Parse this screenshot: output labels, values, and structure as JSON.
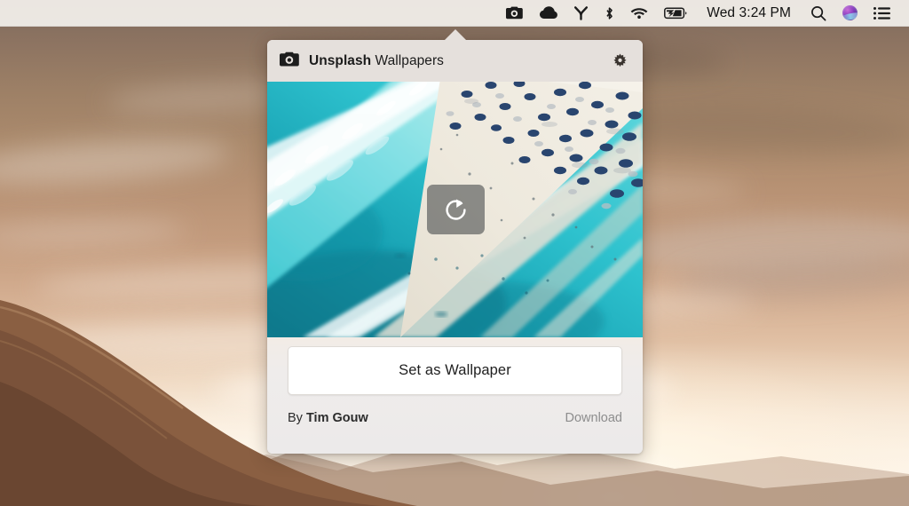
{
  "menubar": {
    "status_icons": [
      {
        "name": "camera-icon",
        "label": "Unsplash Wallpapers"
      },
      {
        "name": "cloud-icon",
        "label": "Cloud"
      },
      {
        "name": "git-branch-icon",
        "label": "Git"
      },
      {
        "name": "bluetooth-icon",
        "label": "Bluetooth"
      },
      {
        "name": "wifi-icon",
        "label": "Wi-Fi"
      },
      {
        "name": "battery-charging-icon",
        "label": "Battery Charging"
      }
    ],
    "clock": "Wed 3:24 PM",
    "right_icons": [
      {
        "name": "search-icon",
        "label": "Spotlight Search"
      },
      {
        "name": "siri-icon",
        "label": "Siri"
      },
      {
        "name": "notification-center-icon",
        "label": "Notification Center"
      }
    ]
  },
  "popover": {
    "header": {
      "app_icon": "camera-icon",
      "brand": "Unsplash",
      "subtitle": "Wallpapers",
      "settings_icon": "gear-icon"
    },
    "photo": {
      "alt": "Aerial view of turquoise ocean waves meeting a sandy beach lined with rows of blue umbrellas",
      "refresh_icon": "refresh-icon",
      "refresh_label": "Refresh"
    },
    "actions": {
      "set_wallpaper_label": "Set as Wallpaper",
      "download_label": "Download"
    },
    "credit": {
      "prefix": "By",
      "author": "Tim Gouw"
    }
  },
  "colors": {
    "popover_header_bg": "#e5e0dc",
    "popover_footer_bg": "#eceaea",
    "button_bg": "#ffffff",
    "download_text": "#8d8d8d",
    "menubar_bg": "#f3f0ec",
    "ocean_teal": "#1fa8b8",
    "sand": "#e8e2d4",
    "umbrella_blue": "#2a4a7a"
  }
}
